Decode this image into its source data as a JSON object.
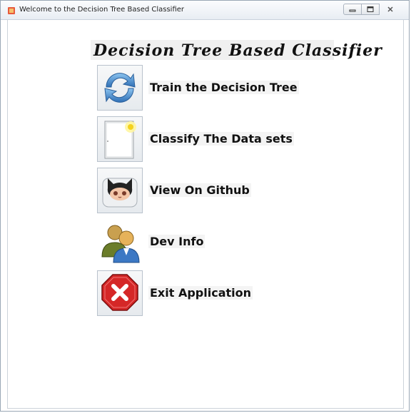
{
  "window": {
    "title": "Welcome to the Decision Tree Based Classifier",
    "controls": [
      "minimize",
      "maximize",
      "close"
    ]
  },
  "heading": "Decision Tree Based Classifier",
  "menu": {
    "items": [
      {
        "label": "Train the Decision Tree",
        "icon": "refresh-icon"
      },
      {
        "label": "Classify The Data sets",
        "icon": "document-icon"
      },
      {
        "label": "View On Github",
        "icon": "github-octocat-icon"
      },
      {
        "label": "Dev Info",
        "icon": "users-icon"
      },
      {
        "label": "Exit Application",
        "icon": "stop-x-icon"
      }
    ]
  },
  "colors": {
    "title_bar": "#e8edf3",
    "refresh_blue": "#3b82c4",
    "stop_red": "#cc1f1f"
  }
}
